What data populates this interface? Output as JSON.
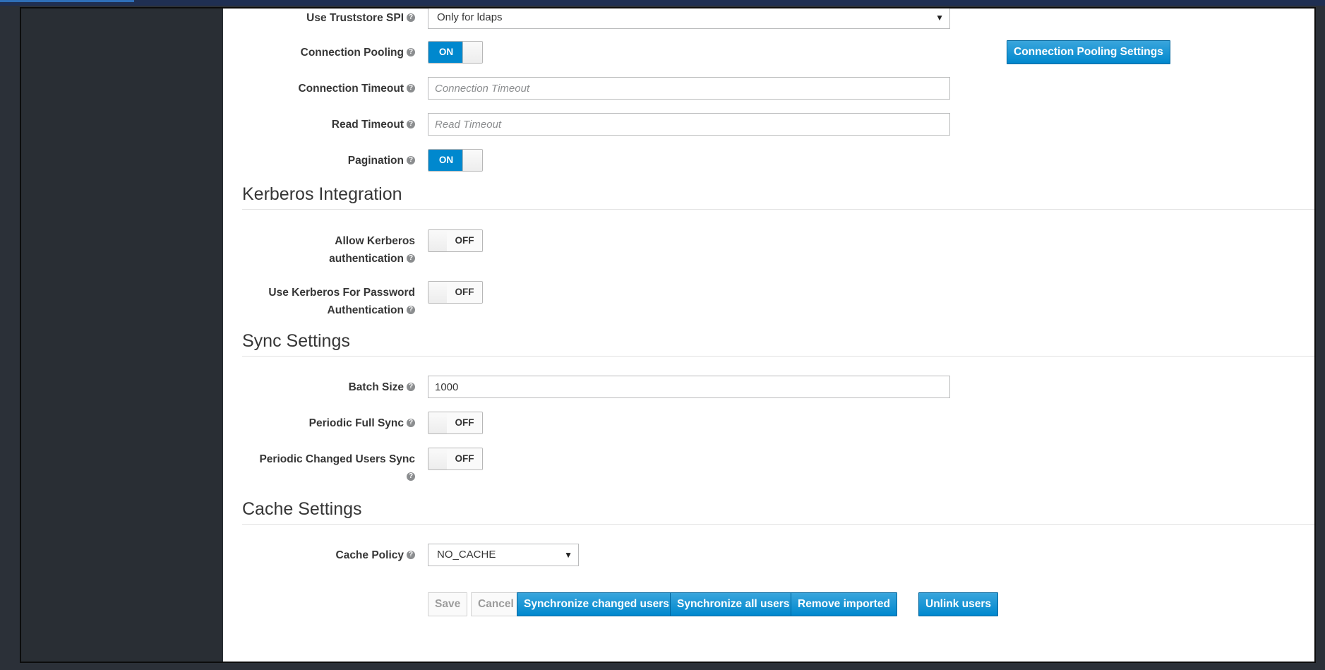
{
  "fields": {
    "truststore": {
      "label": "Use Truststore SPI",
      "value": "Only for ldaps"
    },
    "pooling": {
      "label": "Connection Pooling",
      "state": "ON",
      "settings_button": "Connection Pooling Settings"
    },
    "conn_timeout": {
      "label": "Connection Timeout",
      "placeholder": "Connection Timeout"
    },
    "read_timeout": {
      "label": "Read Timeout",
      "placeholder": "Read Timeout"
    },
    "pagination": {
      "label": "Pagination",
      "state": "ON"
    }
  },
  "kerberos": {
    "title": "Kerberos Integration",
    "allow": {
      "label_line1": "Allow Kerberos",
      "label_line2": "authentication",
      "state": "OFF"
    },
    "password": {
      "label_line1": "Use Kerberos For Password",
      "label_line2": "Authentication",
      "state": "OFF"
    }
  },
  "sync": {
    "title": "Sync Settings",
    "batch": {
      "label": "Batch Size",
      "value": "1000"
    },
    "full": {
      "label": "Periodic Full Sync",
      "state": "OFF"
    },
    "changed": {
      "label": "Periodic Changed Users Sync",
      "state": "OFF"
    }
  },
  "cache": {
    "title": "Cache Settings",
    "policy": {
      "label": "Cache Policy",
      "value": "NO_CACHE"
    }
  },
  "actions": {
    "save": "Save",
    "cancel": "Cancel",
    "sync_changed": "Synchronize changed users",
    "sync_all": "Synchronize all users",
    "remove_imported": "Remove imported",
    "unlink": "Unlink users"
  },
  "icons": {
    "help": "question-circle-icon",
    "caret": "caret-down-icon"
  },
  "colors": {
    "primary": "#0088ce",
    "sidebar": "#292e34"
  }
}
